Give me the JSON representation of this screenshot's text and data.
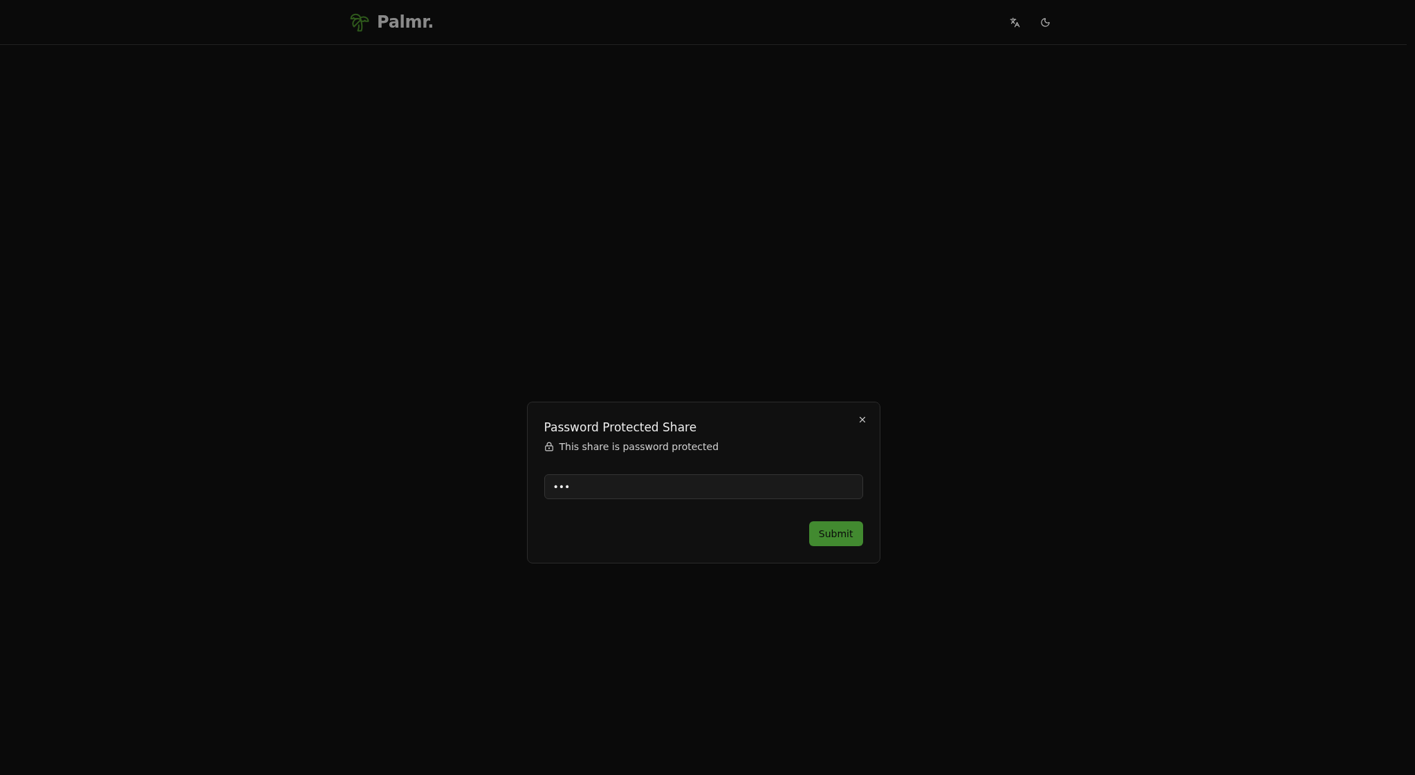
{
  "header": {
    "logo": {
      "text": "Palmr."
    }
  },
  "dialog": {
    "title": "Password Protected Share",
    "description": "This share is password protected",
    "password_field": {
      "value": "•••"
    },
    "buttons": [
      {
        "label": "Submit"
      }
    ]
  }
}
